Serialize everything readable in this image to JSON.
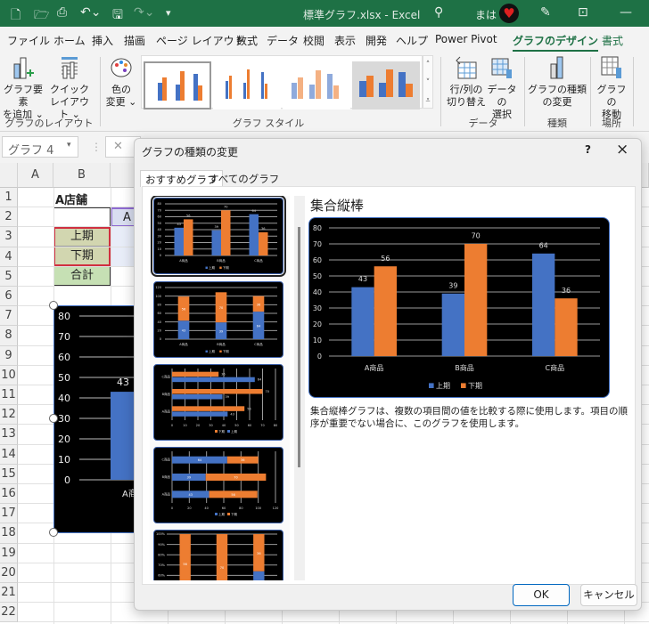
{
  "titlebar": {
    "title": "標準グラフ.xlsx  -  Excel",
    "search_icon": "search-icon",
    "user": "まは",
    "colors": {
      "bar": "#1e7145"
    }
  },
  "menu_tabs": [
    "ファイル",
    "ホーム",
    "挿入",
    "描画",
    "ページ レイアウト",
    "数式",
    "データ",
    "校閲",
    "表示",
    "開発",
    "ヘルプ",
    "Power Pivot",
    "グラフのデザイン",
    "書式"
  ],
  "active_tab": "グラフのデザイン",
  "ribbon": {
    "add_element": "グラフ要素を追加",
    "add_element_l1": "グラフ要素",
    "add_element_l2": "を追加 ⌄",
    "quick_layout_l1": "クイック",
    "quick_layout_l2": "レイアウト ⌄",
    "group_layout": "グラフのレイアウト",
    "color_l1": "色の",
    "color_l2": "変更 ⌄",
    "group_styles": "グラフ スタイル",
    "switch_l1": "行/列の",
    "switch_l2": "切り替え",
    "select_l1": "データの",
    "select_l2": "選択",
    "group_data": "データ",
    "change_type_l1": "グラフの種類",
    "change_type_l2": "の変更",
    "group_type": "種類",
    "move_l1": "グラフの",
    "move_l2": "移動",
    "group_location": "場所"
  },
  "namebox": "グラフ 4",
  "sheet": {
    "columns": [
      "A",
      "B"
    ],
    "rows": [
      "1",
      "2",
      "3",
      "4",
      "5",
      "6",
      "7",
      "8",
      "9",
      "10",
      "11",
      "12",
      "13",
      "14",
      "15",
      "16",
      "17",
      "18",
      "19",
      "20",
      "21",
      "22"
    ],
    "b1": "A店舗",
    "c2": "A",
    "b3": "上期",
    "b4": "下期",
    "b5": "合計",
    "chart": {
      "ticks": [
        "80",
        "70",
        "60",
        "50",
        "40",
        "30",
        "20",
        "10",
        "0"
      ],
      "label": "43",
      "category": "A商"
    }
  },
  "dialog": {
    "title": "グラフの種類の変更",
    "help": "?",
    "close": "×",
    "tabs": [
      "おすすめグラフ",
      "すべてのグラフ"
    ],
    "preview_title": "集合縦棒",
    "description": "集合縦棒グラフは、複数の項目間の値を比較する際に使用します。項目の順序が重要でない場合に、このグラフを使用します。",
    "ok": "OK",
    "cancel": "キャンセル"
  },
  "chart_data": {
    "type": "bar",
    "categories": [
      "A商品",
      "B商品",
      "C商品"
    ],
    "series": [
      {
        "name": "上期",
        "values": [
          43,
          39,
          64
        ],
        "color": "#4472c4"
      },
      {
        "name": "下期",
        "values": [
          56,
          70,
          36
        ],
        "color": "#ed7d31"
      }
    ],
    "ylim": [
      0,
      80
    ],
    "yticks": [
      0,
      10,
      20,
      30,
      40,
      50,
      60,
      70,
      80
    ],
    "grid": true,
    "legend": "bottom",
    "data_labels": true,
    "background": "#000000"
  }
}
